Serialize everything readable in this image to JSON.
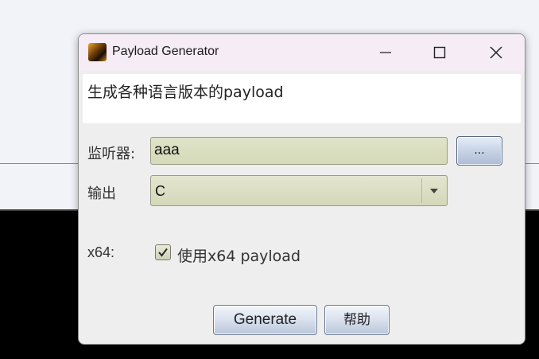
{
  "window": {
    "title": "Payload Generator",
    "description": "生成各种语言版本的payload"
  },
  "form": {
    "listener_label": "监听器:",
    "listener_value": "aaa",
    "browse_label": "...",
    "output_label": "输出",
    "output_value": "C",
    "x64_label": "x64:",
    "x64_checkbox_label": "使用x64 payload",
    "x64_checked": true
  },
  "buttons": {
    "generate": "Generate",
    "help": "帮助"
  },
  "icons": {
    "app": "app-icon",
    "minimize": "minimize-icon",
    "maximize": "maximize-icon",
    "close": "close-icon",
    "dropdown": "chevron-down-icon",
    "check": "checkmark-icon"
  }
}
